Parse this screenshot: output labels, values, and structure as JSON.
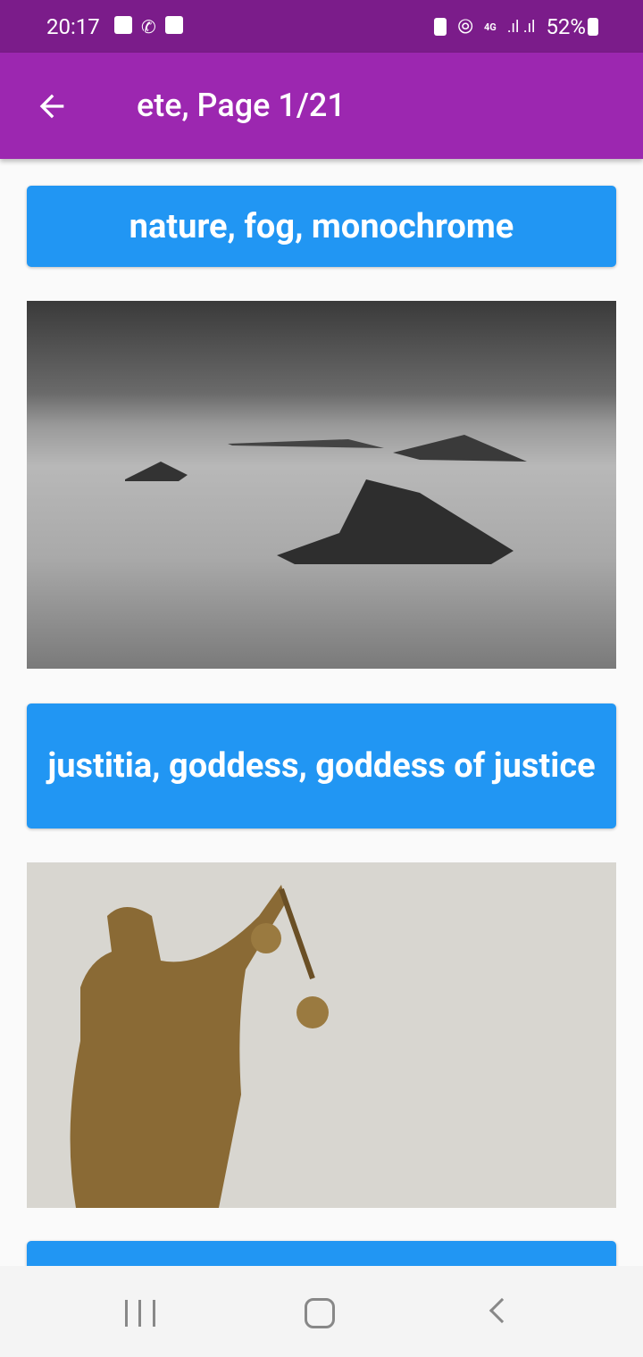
{
  "status_bar": {
    "time": "20:17",
    "battery": "52%",
    "network": "4G"
  },
  "app_bar": {
    "title": "ete, Page 1/21"
  },
  "items": [
    {
      "label": "nature, fog, monochrome"
    },
    {
      "label": "justitia, goddess, goddess of justice"
    },
    {
      "label": ""
    }
  ]
}
